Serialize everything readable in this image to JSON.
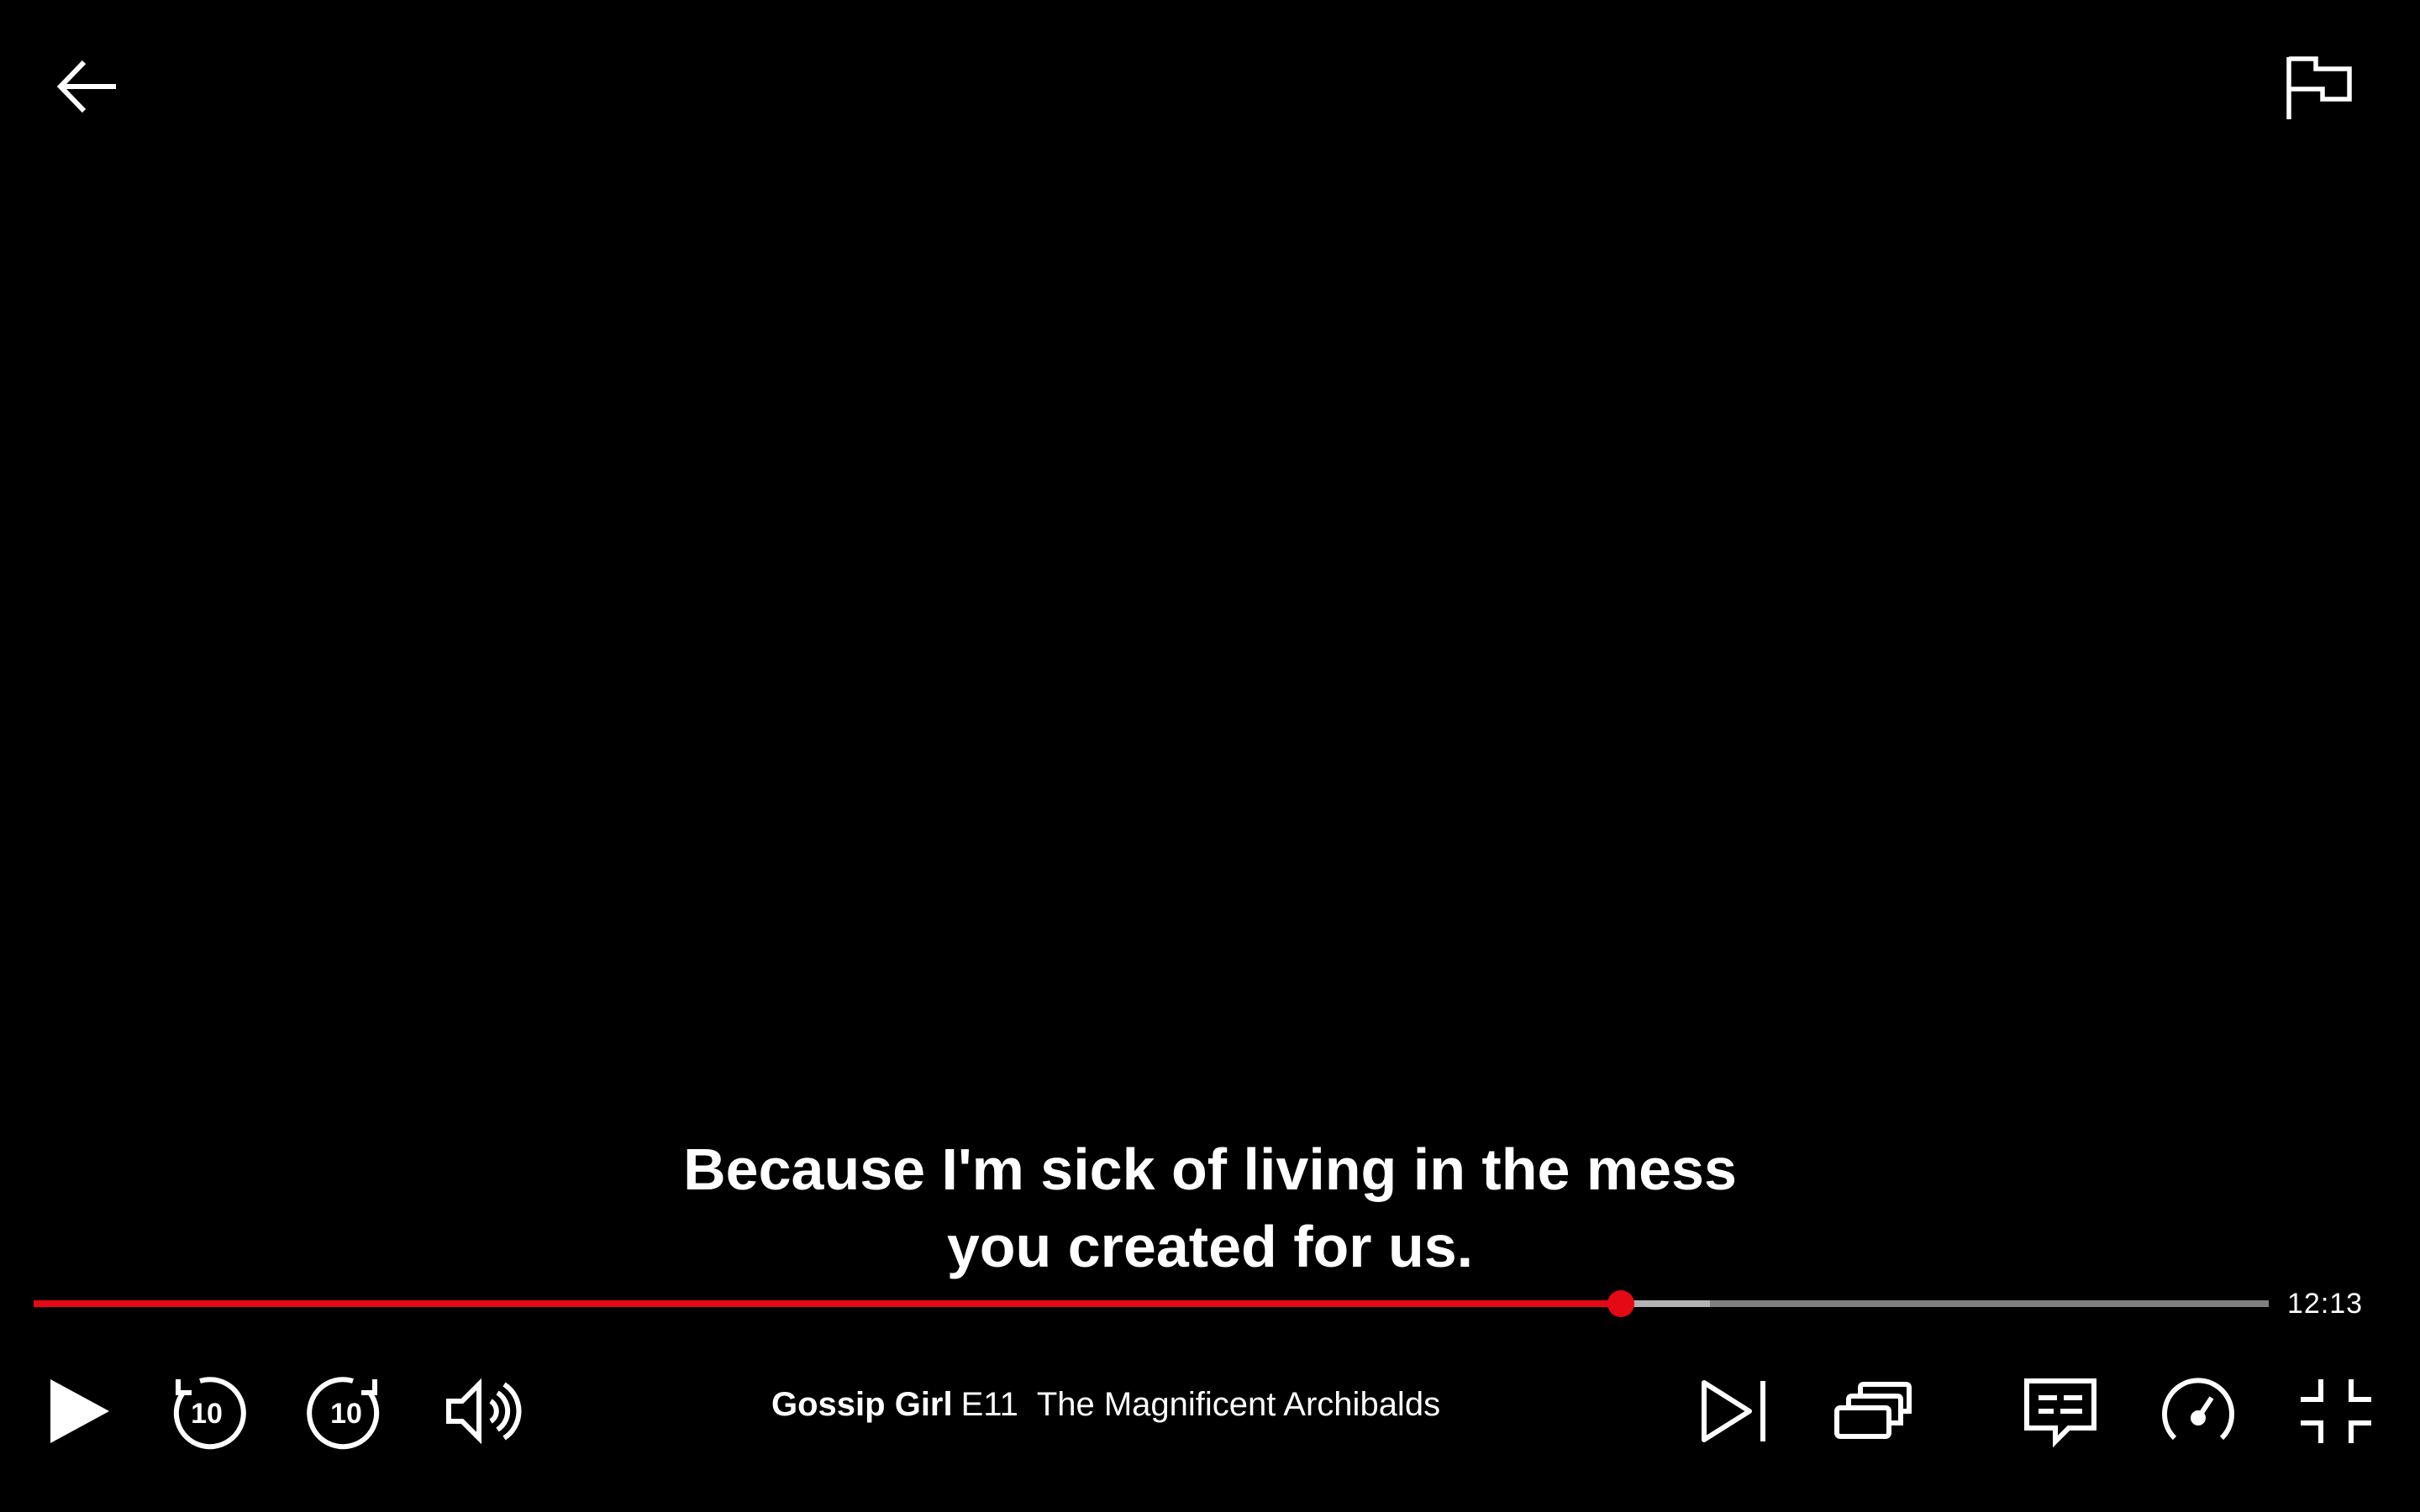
{
  "subtitle": {
    "line1": "Because I'm sick of living in the mess",
    "line2": "you created for us."
  },
  "progress": {
    "played_fraction": 0.71,
    "buffered_fraction": 0.75,
    "time_remaining": "12:13",
    "played_color": "#e50914",
    "track_color": "#808080",
    "buffered_color": "#b3b3b3"
  },
  "title_info": {
    "show": "Gossip Girl",
    "episode": "E11",
    "episode_title": "The Magnificent Archibalds"
  },
  "controls": {
    "skip_seconds": "10",
    "icons": {
      "back": "arrow-left-icon",
      "report": "flag-icon",
      "play": "play-icon",
      "rewind": "rewind-10-icon",
      "forward": "forward-10-icon",
      "volume": "volume-high-icon",
      "next": "next-episode-icon",
      "episodes": "episodes-icon",
      "subtitles": "subtitles-audio-icon",
      "speed": "playback-speed-icon",
      "fullscreen": "exit-fullscreen-icon"
    }
  }
}
